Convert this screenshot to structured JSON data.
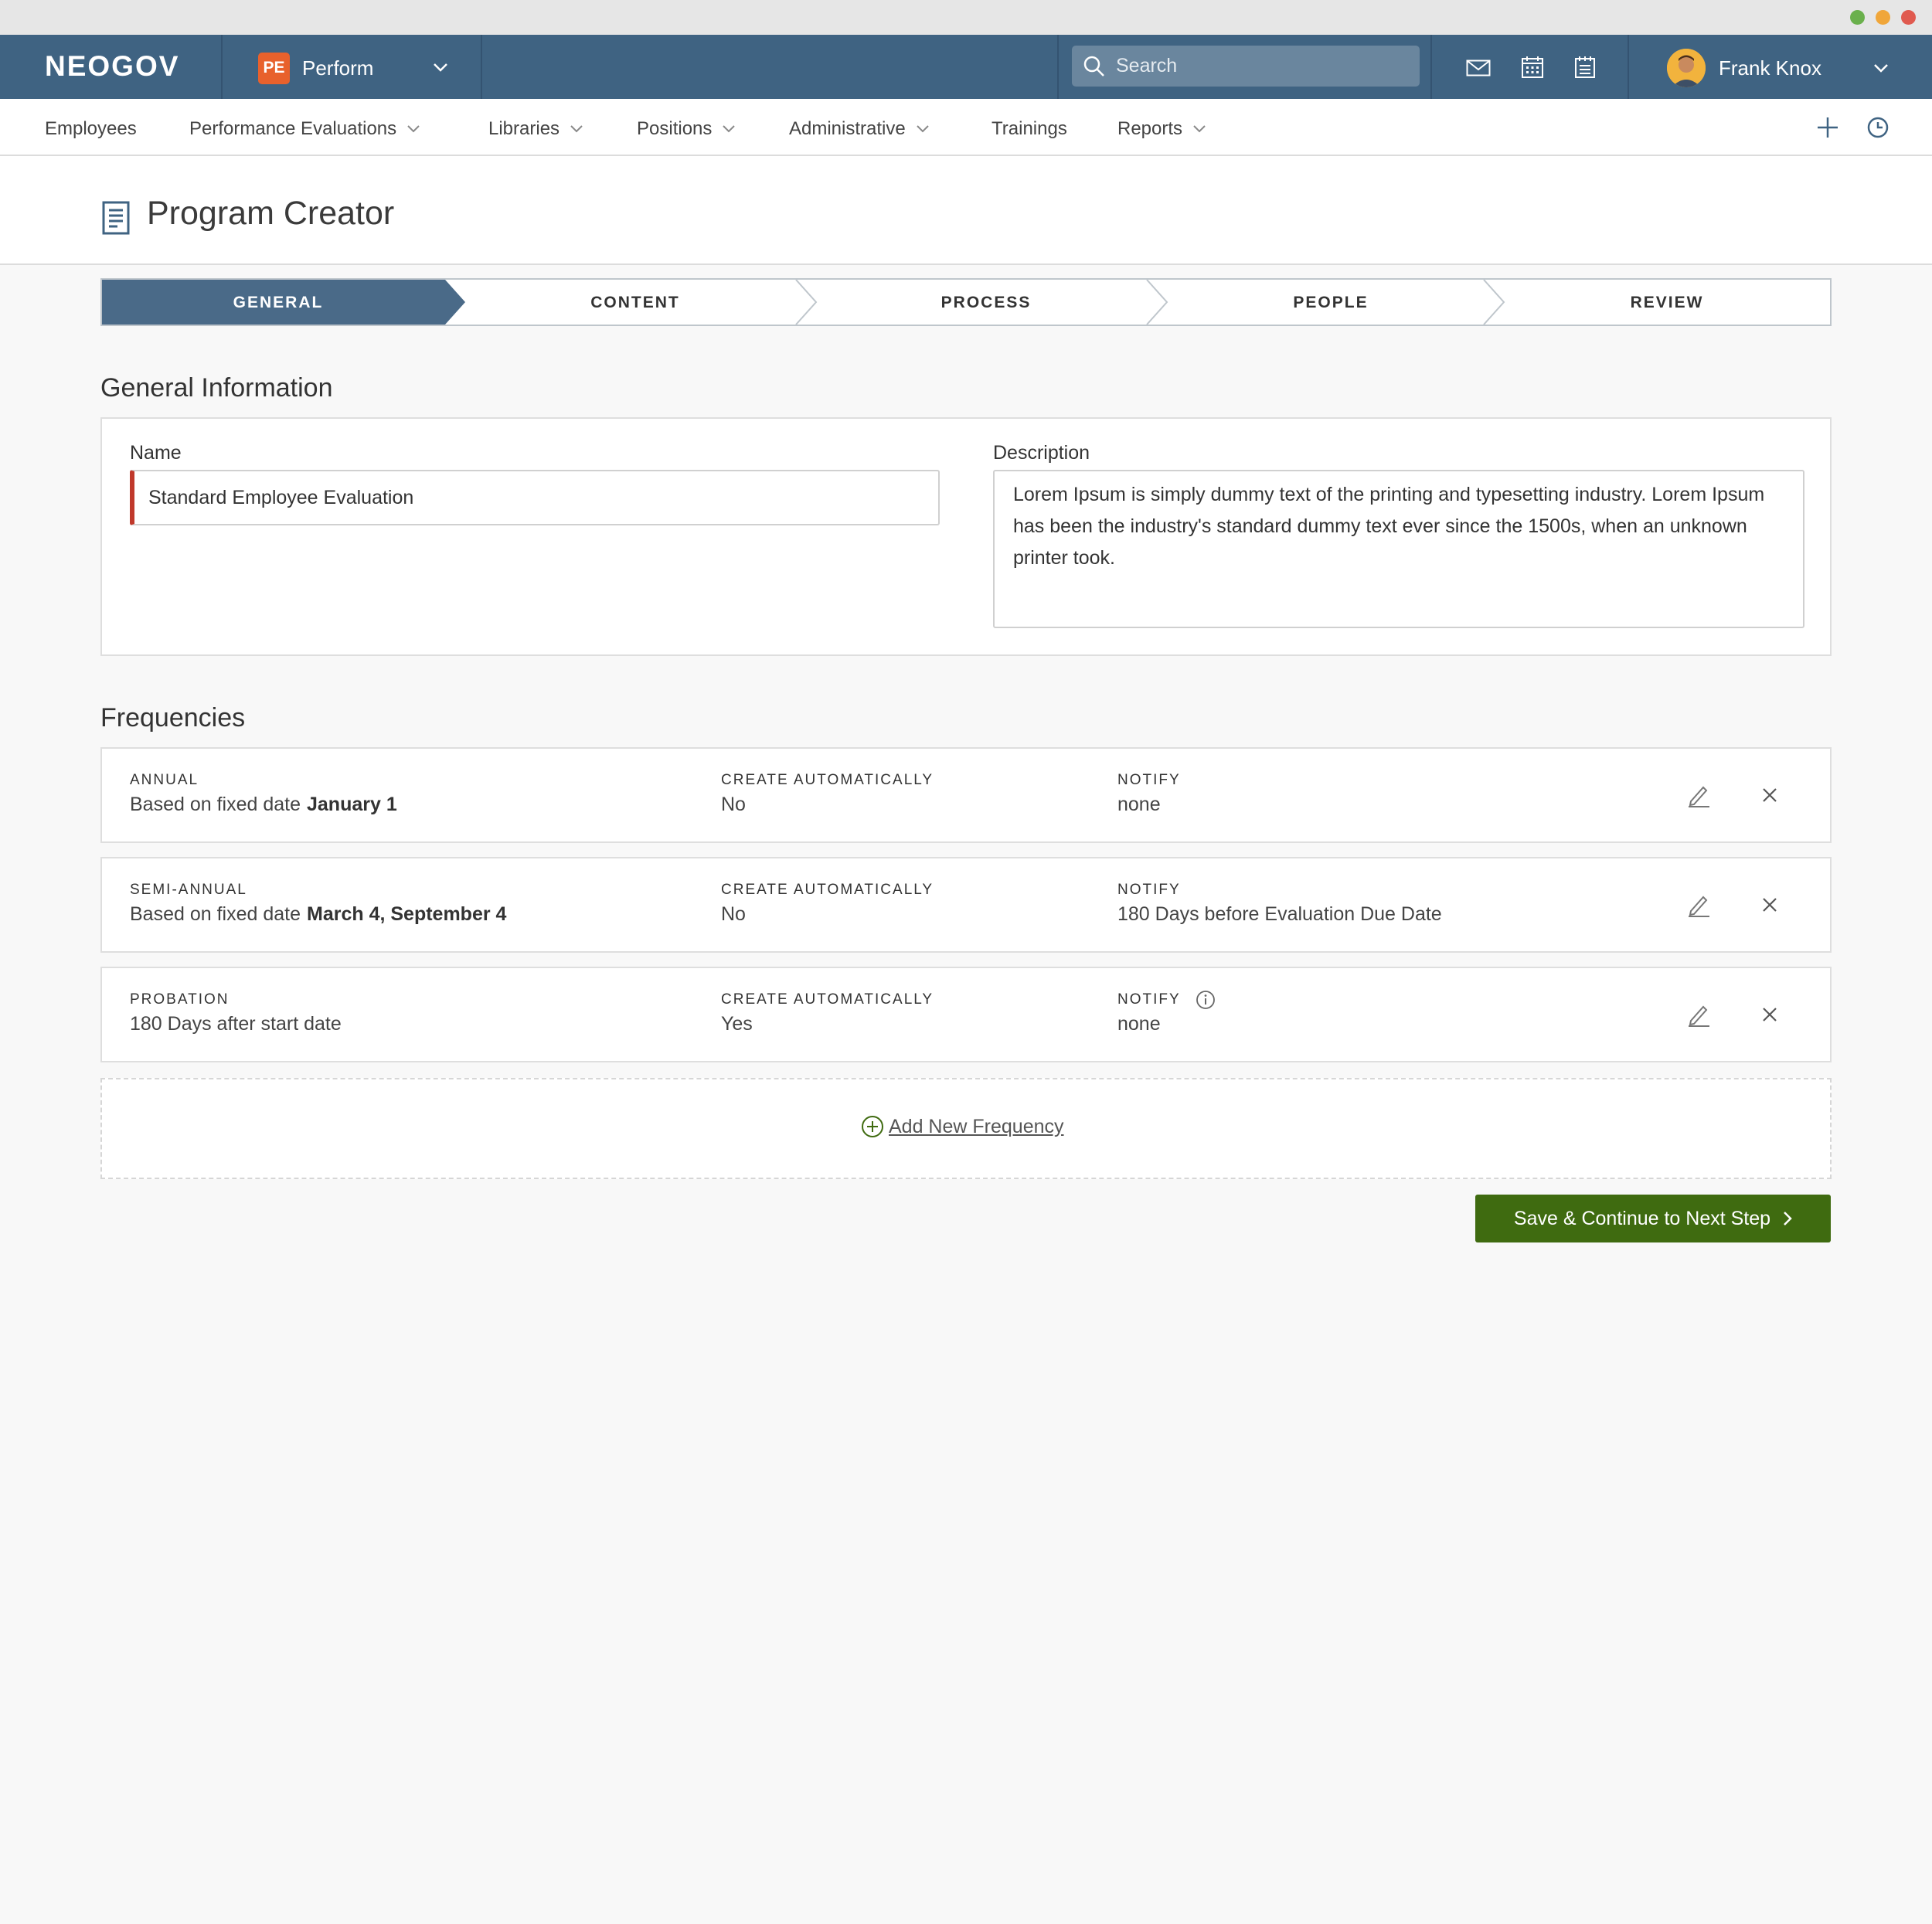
{
  "window": {
    "dots": [
      "#6ab04c",
      "#f0a63a",
      "#e05a4f"
    ]
  },
  "topbar": {
    "logo": "NEOGOV",
    "app": {
      "badge": "PE",
      "name": "Perform",
      "badge_color": "#e8612c"
    },
    "search": {
      "placeholder": "Search"
    },
    "icons": [
      "mail-icon",
      "calendar-icon",
      "notepad-icon"
    ],
    "user": {
      "name": "Frank Knox"
    },
    "bar_color": "#3f6382"
  },
  "nav": {
    "items": [
      {
        "label": "Employees",
        "dropdown": false
      },
      {
        "label": "Performance Evaluations",
        "dropdown": true
      },
      {
        "label": "Libraries",
        "dropdown": true
      },
      {
        "label": "Positions",
        "dropdown": true
      },
      {
        "label": "Administrative",
        "dropdown": true
      },
      {
        "label": "Trainings",
        "dropdown": false
      },
      {
        "label": "Reports",
        "dropdown": true
      }
    ],
    "right_icons": [
      "add-icon",
      "history-clock-icon"
    ]
  },
  "page": {
    "title": "Program Creator"
  },
  "stepper": {
    "steps": [
      "GENERAL",
      "CONTENT",
      "PROCESS",
      "PEOPLE",
      "REVIEW"
    ],
    "active_index": 0,
    "active_color": "#4a6a88"
  },
  "general": {
    "title": "General Information",
    "name_label": "Name",
    "name_value": "Standard Employee Evaluation",
    "description_label": "Description",
    "description_value": "Lorem Ipsum is simply dummy text of the printing and typesetting industry. Lorem Ipsum has been the industry's standard dummy text ever since the 1500s, when an unknown printer took."
  },
  "frequencies": {
    "title": "Frequencies",
    "items": [
      {
        "type": "ANNUAL",
        "desc": "Based on fixed date",
        "date": "January 1",
        "auto_label": "CREATE AUTOMATICALLY",
        "auto": "No",
        "notify_label": "NOTIFY",
        "notify": "none",
        "info": false
      },
      {
        "type": "SEMI-ANNUAL",
        "desc": "Based on fixed date",
        "date": "March 4, September 4",
        "auto_label": "CREATE AUTOMATICALLY",
        "auto": "No",
        "notify_label": "NOTIFY",
        "notify": "180 Days before Evaluation Due Date",
        "info": false
      },
      {
        "type": "PROBATION",
        "desc": "180 Days after start date",
        "date": "",
        "auto_label": "CREATE AUTOMATICALLY",
        "auto": "Yes",
        "notify_label": "NOTIFY",
        "notify": "none",
        "info": true
      }
    ],
    "add_label": "Add New Frequency"
  },
  "actions": {
    "save_label": "Save & Continue to Next Step",
    "save_color": "#3f6b10"
  }
}
